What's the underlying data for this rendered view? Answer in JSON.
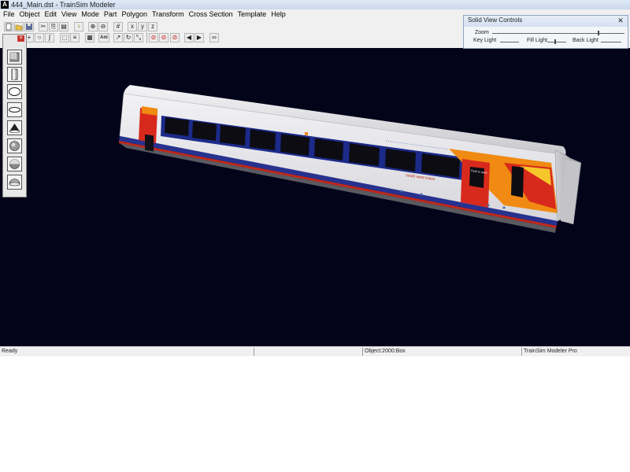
{
  "window": {
    "title": "444_Main.dst - TrainSim Modeler",
    "icon_letter": "A"
  },
  "menu": [
    {
      "label": "File"
    },
    {
      "label": "Object"
    },
    {
      "label": "Edit"
    },
    {
      "label": "View"
    },
    {
      "label": "Mode"
    },
    {
      "label": "Part"
    },
    {
      "label": "Polygon"
    },
    {
      "label": "Transform"
    },
    {
      "label": "Cross Section"
    },
    {
      "label": "Template"
    },
    {
      "label": "Help"
    }
  ],
  "toolbar": {
    "buttons": [
      {
        "icon": "new-file-icon",
        "glyph": ""
      },
      {
        "icon": "open-folder-icon",
        "glyph": ""
      },
      {
        "icon": "save-icon",
        "glyph": ""
      },
      {
        "icon": "cut-icon",
        "glyph": "✂"
      },
      {
        "icon": "copy-icon",
        "glyph": "⎘"
      },
      {
        "icon": "paste-icon",
        "glyph": "▤"
      },
      {
        "icon": "light-icon",
        "glyph": "♀"
      },
      {
        "icon": "zoom-in-icon",
        "glyph": "⊕"
      },
      {
        "icon": "zoom-out-icon",
        "glyph": "⊖"
      },
      {
        "icon": "grid-icon",
        "glyph": "#"
      },
      {
        "icon": "x-axis-icon",
        "glyph": "x"
      },
      {
        "icon": "y-axis-icon",
        "glyph": "y"
      },
      {
        "icon": "z-axis-icon",
        "glyph": "z"
      },
      {
        "icon": "no-select-icon",
        "glyph": "⊘"
      },
      {
        "icon": "no-move-icon",
        "glyph": "⊘"
      },
      {
        "icon": "no-rotate-icon",
        "glyph": "⊘"
      },
      {
        "icon": "previous-icon",
        "glyph": "◀"
      },
      {
        "icon": "next-icon",
        "glyph": "▶"
      },
      {
        "icon": "binoculars-icon",
        "glyph": "∞"
      },
      {
        "icon": "sphere-tool-icon",
        "glyph": "○"
      },
      {
        "icon": "spline-icon",
        "glyph": "∫"
      },
      {
        "icon": "select-rect-icon",
        "glyph": "⬚"
      },
      {
        "icon": "select-lines-icon",
        "glyph": "≡"
      },
      {
        "icon": "texture-icon",
        "glyph": "▦"
      },
      {
        "icon": "ani-icon",
        "glyph": "Ani"
      },
      {
        "icon": "move-icon",
        "glyph": "↗"
      },
      {
        "icon": "rotate-icon",
        "glyph": "↻"
      },
      {
        "icon": "scale-icon",
        "glyph": "⤡"
      },
      {
        "icon": "pan-icon",
        "glyph": "✥"
      }
    ]
  },
  "palette": {
    "tools": [
      {
        "icon": "cube-tool-icon"
      },
      {
        "icon": "cylinder-tool-icon"
      },
      {
        "icon": "disc-tool-icon"
      },
      {
        "icon": "flat-disc-tool-icon"
      },
      {
        "icon": "cone-tool-icon"
      },
      {
        "icon": "sphere-tool-icon"
      },
      {
        "icon": "hemisphere-tool-icon"
      },
      {
        "icon": "shell-tool-icon"
      }
    ]
  },
  "solid_view": {
    "title": "Solid View Controls",
    "close": "✕",
    "zoom_label": "Zoom",
    "key_light_label": "Key Light",
    "fill_light_label": "Fill Light",
    "back_light_label": "Back Light"
  },
  "model": {
    "livery_text": "south west trains",
    "door_label": "Push to open"
  },
  "statusbar": {
    "ready": "Ready",
    "object": "Object:2000:Box",
    "product": "TrainSim Modeler Pro"
  },
  "colors": {
    "viewport_bg": "#03031a",
    "livery_red": "#d82a1c",
    "livery_orange": "#f08a12",
    "livery_blue": "#27318f",
    "body_white": "#e8e8ee"
  }
}
